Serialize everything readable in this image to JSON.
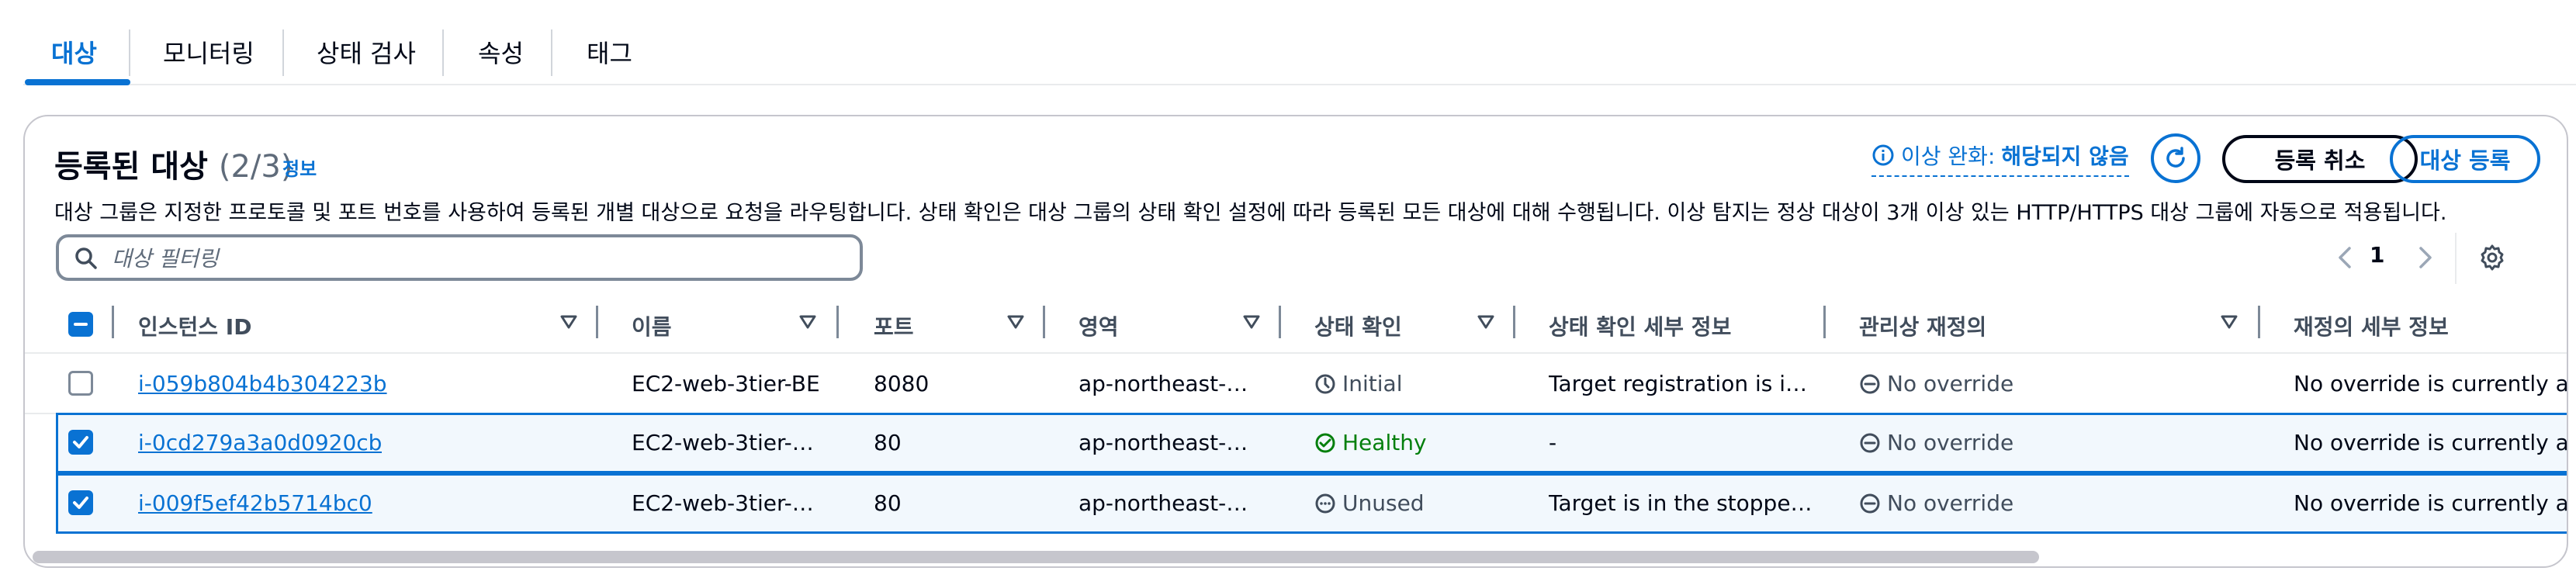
{
  "tabs": [
    "대상",
    "모니터링",
    "상태 검사",
    "속성",
    "태그"
  ],
  "panel": {
    "title": "등록된 대상",
    "count": "(2/3)",
    "info": "정보",
    "description": "대상 그룹은 지정한 프로토콜 및 포트 번호를 사용하여 등록된 개별 대상으로 요청을 라우팅합니다. 상태 확인은 대상 그룹의 상태 확인 설정에 따라 등록된 모든 대상에 대해 수행됩니다. 이상 탐지는 정상 대상이 3개 이상 있는 HTTP/HTTPS 대상 그룹에 자동으로 적용됩니다.",
    "anomaly_label": "이상 완화:",
    "anomaly_value": "해당되지 않음",
    "deregister_label": "등록 취소",
    "register_label": "대상 등록",
    "search_placeholder": "대상 필터링",
    "page_number": "1"
  },
  "columns": [
    "인스턴스 ID",
    "이름",
    "포트",
    "영역",
    "상태 확인",
    "상태 확인 세부 정보",
    "관리상 재정의",
    "재정의 세부 정보"
  ],
  "rows": [
    {
      "instance_id": "i-059b804b4b304223b",
      "name": "EC2-web-3tier-BE",
      "port": "8080",
      "zone": "ap-northeast-…",
      "health": "Initial",
      "health_detail": "Target registration is i…",
      "override": "No override",
      "override_detail": "No override is currently ac",
      "selected": false
    },
    {
      "instance_id": "i-0cd279a3a0d0920cb",
      "name": "EC2-web-3tier-…",
      "port": "80",
      "zone": "ap-northeast-…",
      "health": "Healthy",
      "health_detail": "-",
      "override": "No override",
      "override_detail": "No override is currently ac",
      "selected": true
    },
    {
      "instance_id": "i-009f5ef42b5714bc0",
      "name": "EC2-web-3tier-…",
      "port": "80",
      "zone": "ap-northeast-…",
      "health": "Unused",
      "health_detail": "Target is in the stoppe…",
      "override": "No override",
      "override_detail": "No override is currently ac",
      "selected": true
    }
  ],
  "colors": {
    "accent": "#0972d3",
    "healthy": "#037f0c",
    "muted": "#5f6b7a",
    "text": "#000716"
  }
}
